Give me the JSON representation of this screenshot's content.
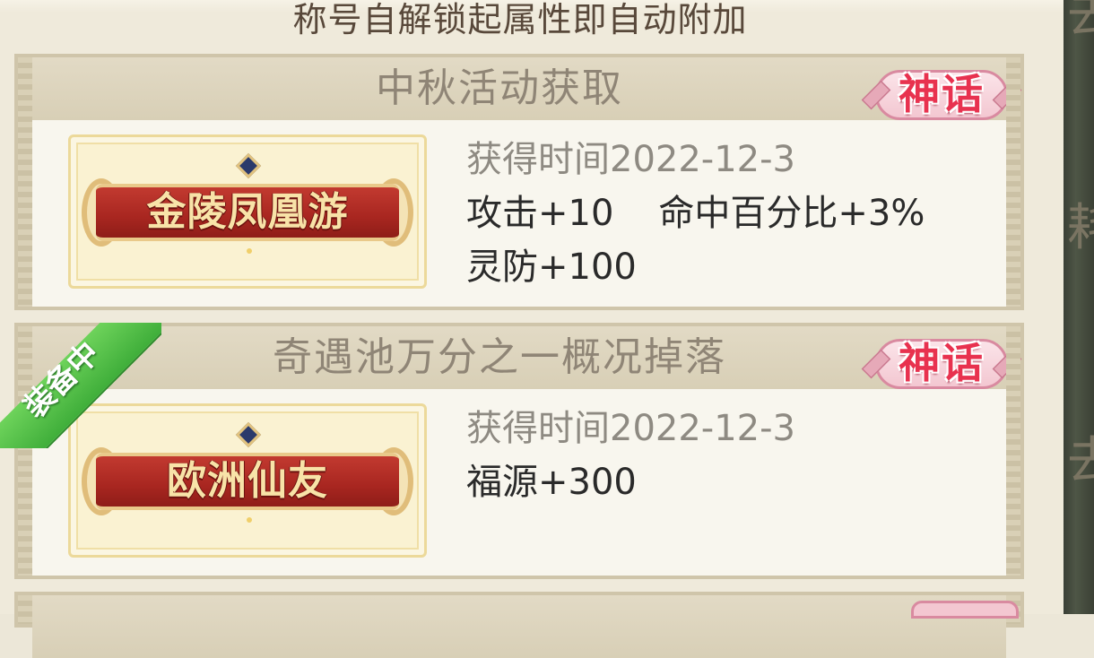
{
  "header": {
    "text": "称号自解锁起属性即自动附加"
  },
  "cards": [
    {
      "source": "中秋活动获取",
      "rarity": "神话",
      "title_name": "金陵凤凰游",
      "time_label": "获得时间2022-12-3",
      "attributes": [
        "攻击+10",
        "命中百分比+3%",
        "灵防+100"
      ],
      "equipped": false
    },
    {
      "source": "奇遇池万分之一概况掉落",
      "rarity": "神话",
      "title_name": "欧洲仙友",
      "time_label": "获得时间2022-12-3",
      "attributes": [
        "福源+300"
      ],
      "equipped": true,
      "equipped_label": "装备中"
    }
  ],
  "side": {
    "glyphs": [
      "去",
      "耗",
      "去"
    ]
  },
  "colors": {
    "rarity": "#e8324f",
    "banner": "#a82620",
    "equipped": "#3fae3a"
  }
}
